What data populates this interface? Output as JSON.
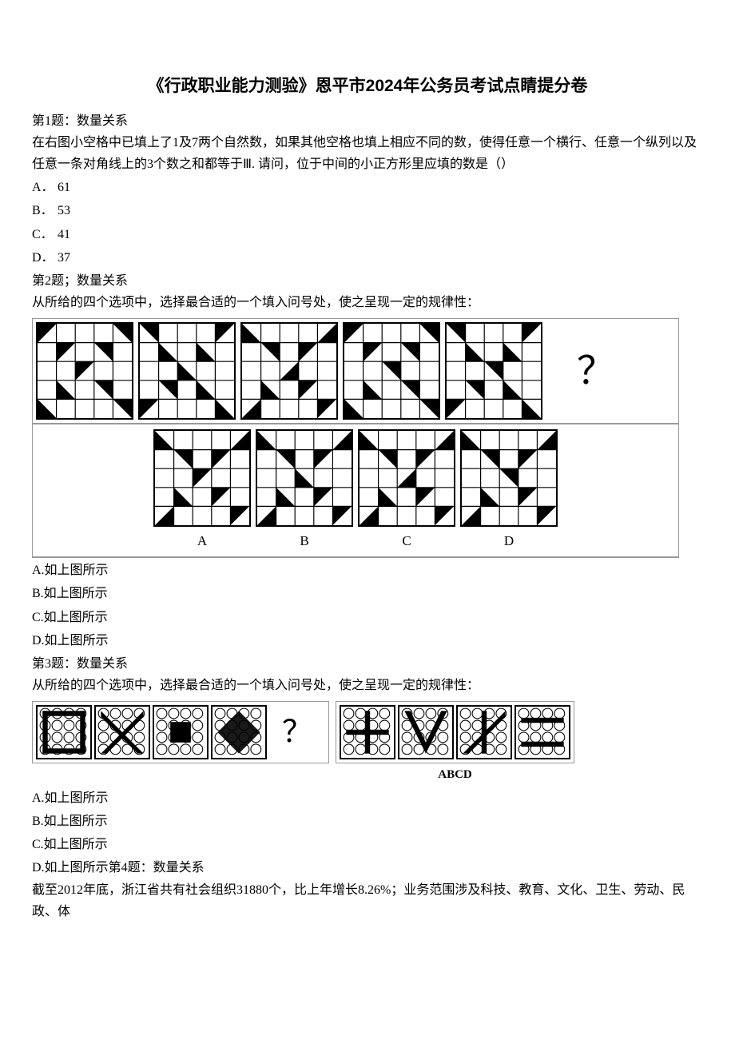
{
  "title": "《行政职业能力测验》恩平市2024年公务员考试点睛提分卷",
  "q1": {
    "header": "第1题：数量关系",
    "text": "在右图小空格中已填上了1及7两个自然数，如果其他空格也填上相应不同的数，使得任意一个横行、任意一个纵列以及任意一条对角线上的3个数之和都等于Ⅲ. 请问，位于中间的小正方形里应填的数是（）",
    "options": {
      "a_letter": "A．",
      "a_text": "61",
      "b_letter": "B．",
      "b_text": "53",
      "c_letter": "C．",
      "c_text": "41",
      "d_letter": "D．",
      "d_text": "37"
    }
  },
  "q2": {
    "header": "第2题；数量关系",
    "text": "从所给的四个选项中，选择最合适的一个填入问号处，使之呈现一定的规律性：",
    "qmark": "？",
    "labels": {
      "a": "A",
      "b": "B",
      "c": "C",
      "d": "D"
    },
    "options": {
      "a": "A.如上图所示",
      "b": "B.如上图所示",
      "c": "C.如上图所示",
      "d": "D.如上图所示"
    }
  },
  "q3": {
    "header": "第3题：数量关系",
    "text": "从所给的四个选项中，选择最合适的一个填入问号处，使之呈现一定的规律性：",
    "qmark": "？",
    "abcd": "ABCD",
    "options": {
      "a": "A.如上图所示",
      "b": "B.如上图所示",
      "c": "C.如上图所示",
      "d_prefix": "D.如上图所示"
    }
  },
  "q4": {
    "header": "第4题：数量关系",
    "text": "截至2012年底，浙江省共有社会组织31880个，比上年增长8.26%；业务范围涉及科技、教育、文化、卫生、劳动、民政、体"
  }
}
